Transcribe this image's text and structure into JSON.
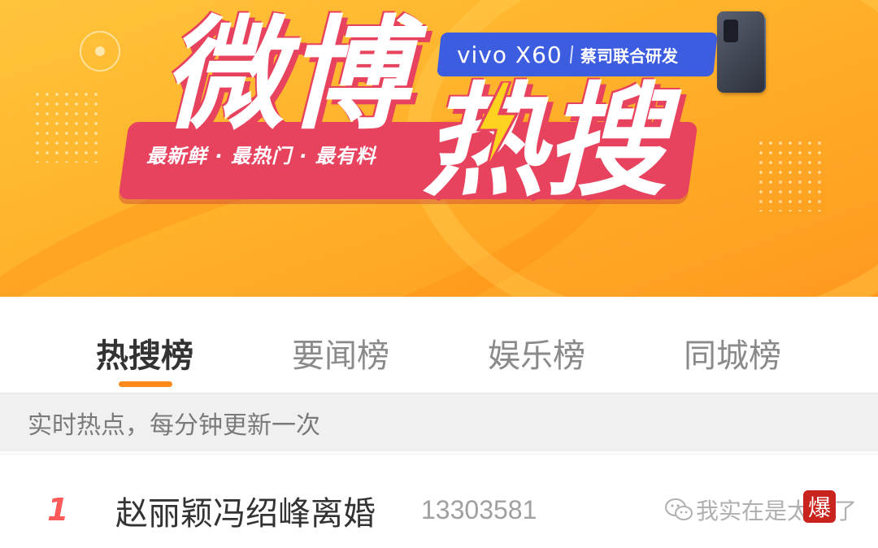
{
  "banner": {
    "title_part1": "微博",
    "title_part2": "热搜",
    "slogan": "最新鲜 · 最热门 · 最有料",
    "sponsor_brand": "vivo X60",
    "sponsor_tagline": "蔡司联合研发"
  },
  "tabs": [
    {
      "label": "热搜榜",
      "active": true
    },
    {
      "label": "要闻榜",
      "active": false
    },
    {
      "label": "娱乐榜",
      "active": false
    },
    {
      "label": "同城榜",
      "active": false
    }
  ],
  "subheader": {
    "text": "实时热点，每分钟更新一次"
  },
  "list": [
    {
      "rank": "1",
      "topic": "赵丽颖冯绍峰离婚",
      "count": "13303581",
      "badge": "爆"
    }
  ],
  "watermark": {
    "text": "我实在是太",
    "text_tail": "了"
  },
  "colors": {
    "accent": "#ff8a1a",
    "rank": "#ff5a5a",
    "badge": "#c9231d",
    "banner_pink": "#e8435e",
    "sponsor_blue": "#3d5de0"
  }
}
